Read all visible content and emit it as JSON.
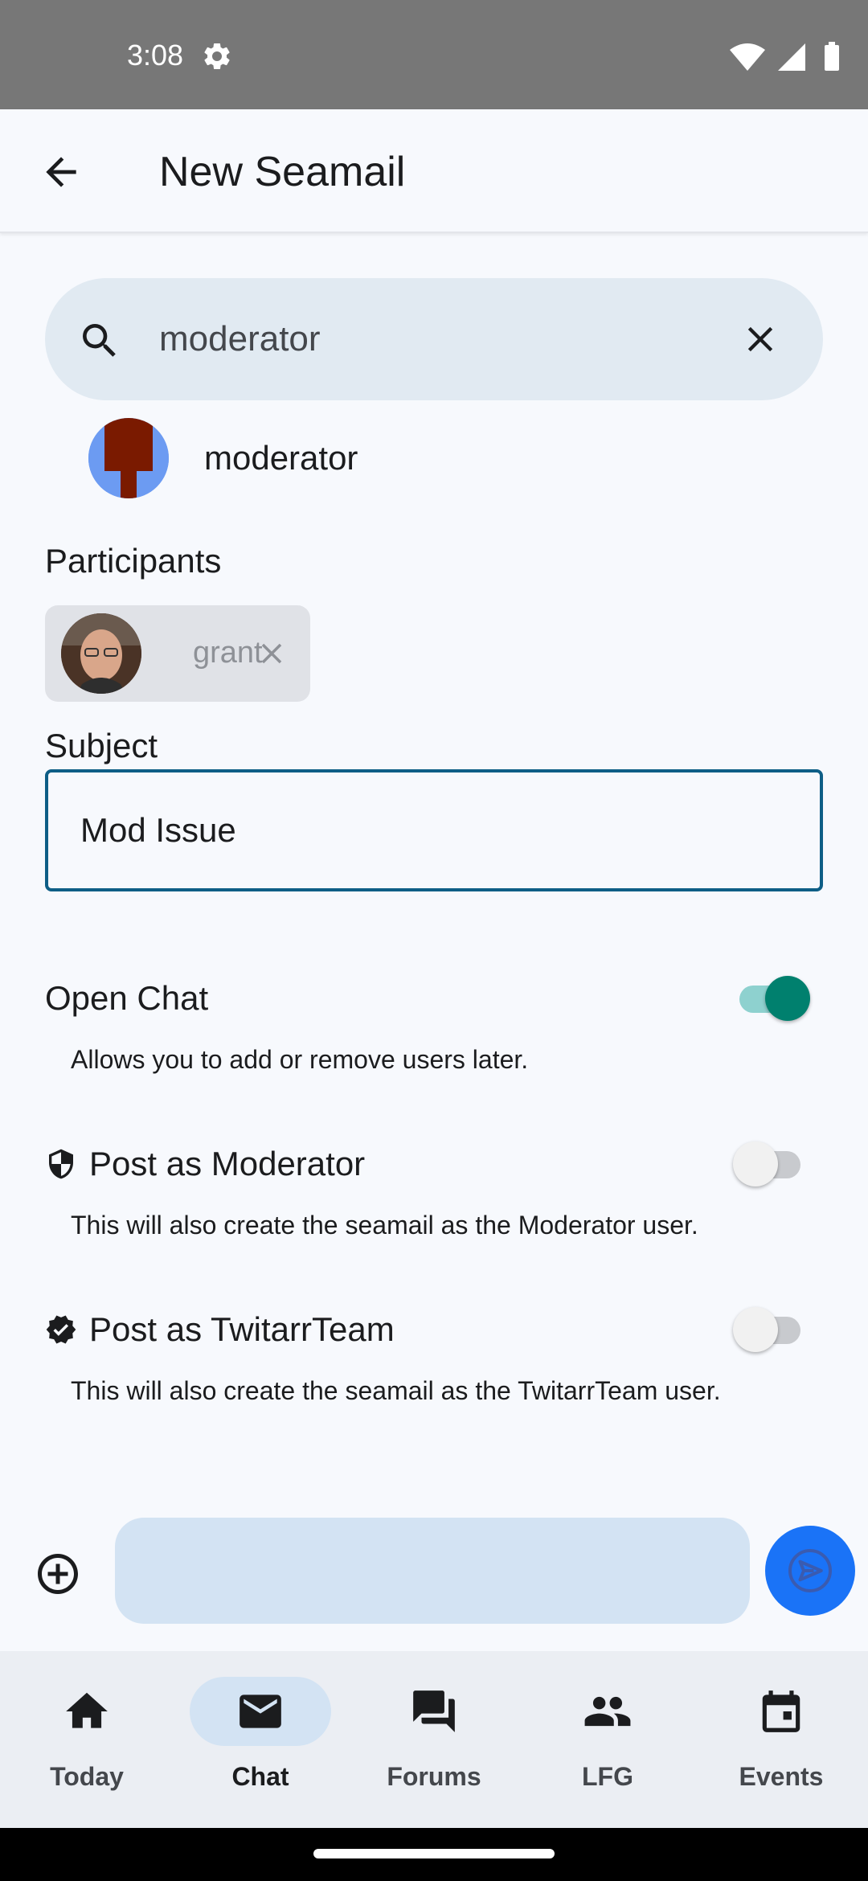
{
  "status_bar": {
    "time": "3:08",
    "icons": [
      "settings-gear-icon",
      "wifi-icon",
      "cell-signal-icon",
      "battery-icon"
    ]
  },
  "app_bar": {
    "title": "New Seamail",
    "back_icon": "arrow-back-icon"
  },
  "search": {
    "value": "moderator",
    "icon": "search-icon",
    "clear_icon": "close-icon"
  },
  "search_result": {
    "name": "moderator"
  },
  "participants": {
    "label": "Participants",
    "chips": [
      {
        "name": "grant"
      }
    ]
  },
  "subject": {
    "label": "Subject",
    "value": "Mod Issue"
  },
  "options": [
    {
      "label": "Open Chat",
      "description": "Allows you to add or remove users later.",
      "checked": true,
      "icon": ""
    },
    {
      "label": "Post as Moderator",
      "description": "This will also create the seamail as the Moderator user.",
      "checked": false,
      "icon": "shield-icon"
    },
    {
      "label": "Post as TwitarrTeam",
      "description": "This will also create the seamail as the TwitarrTeam user.",
      "checked": false,
      "icon": "verified-badge-icon"
    }
  ],
  "composer": {
    "value": "",
    "attach_icon": "add-circle-icon",
    "send_icon": "send-icon"
  },
  "bottom_nav": {
    "items": [
      {
        "label": "Today",
        "icon": "home-icon",
        "active": false
      },
      {
        "label": "Chat",
        "icon": "mail-icon",
        "active": true
      },
      {
        "label": "Forums",
        "icon": "forum-icon",
        "active": false
      },
      {
        "label": "LFG",
        "icon": "people-icon",
        "active": false
      },
      {
        "label": "Events",
        "icon": "calendar-icon",
        "active": false
      }
    ]
  },
  "colors": {
    "accent": "#00806E",
    "send_button": "#1A73F7",
    "subject_border": "#0E5E86",
    "search_background": "#E1EAF2"
  }
}
